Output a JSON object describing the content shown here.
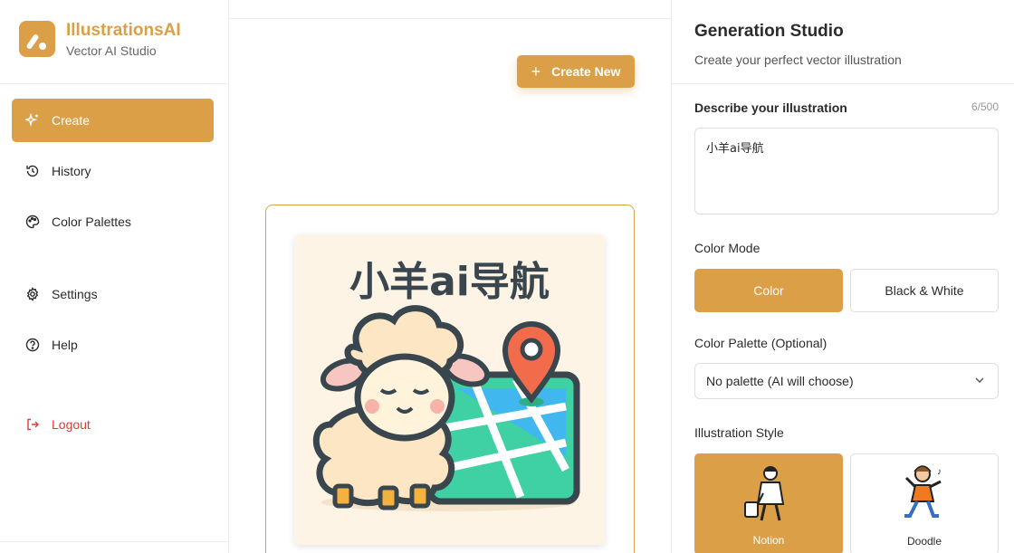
{
  "brand": {
    "name": "IllustrationsAI",
    "subtitle": "Vector AI Studio"
  },
  "nav": {
    "items": [
      {
        "label": "Create",
        "icon": "sparkle-icon",
        "active": true
      },
      {
        "label": "History",
        "icon": "history-icon"
      },
      {
        "label": "Color Palettes",
        "icon": "palette-icon"
      },
      {
        "label": "Settings",
        "icon": "gear-icon"
      },
      {
        "label": "Help",
        "icon": "help-circle-icon"
      }
    ],
    "logout_label": "Logout"
  },
  "main": {
    "create_new_label": "Create New",
    "illustration_title": "小羊ai导航"
  },
  "panel": {
    "title": "Generation Studio",
    "subtitle": "Create your perfect vector illustration",
    "describe_label": "Describe your illustration",
    "char_count": "6/500",
    "prompt_value": "小羊ai导航",
    "color_mode_label": "Color Mode",
    "color_mode_options": [
      "Color",
      "Black & White"
    ],
    "color_mode_selected": "Color",
    "palette_label": "Color Palette (Optional)",
    "palette_selected": "No palette (AI will choose)",
    "style_label": "Illustration Style",
    "styles": [
      "Notion",
      "Doodle"
    ],
    "style_selected": "Notion"
  },
  "colors": {
    "accent": "#dba047",
    "danger": "#e03a3a",
    "border": "#dedede"
  }
}
